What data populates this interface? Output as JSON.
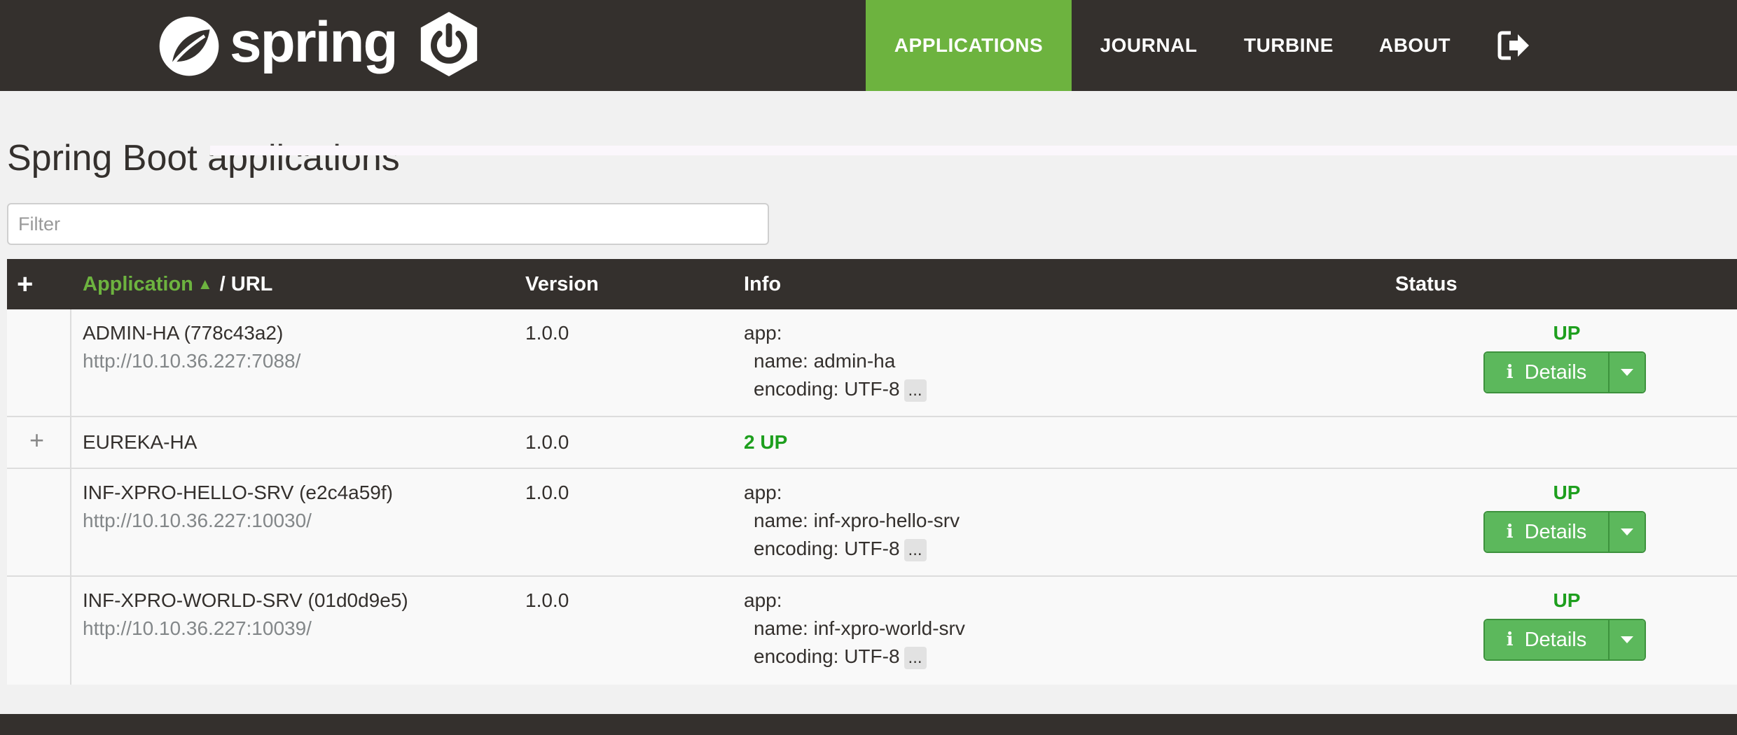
{
  "header": {
    "logo_text": "spring",
    "nav": [
      {
        "label": "APPLICATIONS",
        "active": true
      },
      {
        "label": "JOURNAL",
        "active": false
      },
      {
        "label": "TURBINE",
        "active": false
      },
      {
        "label": "ABOUT",
        "active": false
      }
    ],
    "logout_icon": "sign-out-icon",
    "accent_color": "#6db33f",
    "bar_color": "#34302d"
  },
  "page": {
    "title": "Spring Boot applications",
    "filter_placeholder": "Filter"
  },
  "table": {
    "headers": {
      "expand": "+",
      "application": "Application",
      "sort_indicator": "▲",
      "url_suffix": "/ URL",
      "version": "Version",
      "info": "Info",
      "status": "Status"
    },
    "rows": [
      {
        "name": "ADMIN-HA (778c43a2)",
        "url": "http://10.10.36.227:7088/",
        "version": "1.0.0",
        "info_app": "app:",
        "info_name": "name: admin-ha",
        "info_encoding": "encoding: UTF-8",
        "info_more": "...",
        "status": "UP",
        "details_label": "Details"
      },
      {
        "expand": "+",
        "name": "EUREKA-HA",
        "version": "1.0.0",
        "group_status": "2 UP"
      },
      {
        "name": "INF-XPRO-HELLO-SRV (e2c4a59f)",
        "url": "http://10.10.36.227:10030/",
        "version": "1.0.0",
        "info_app": "app:",
        "info_name": "name: inf-xpro-hello-srv",
        "info_encoding": "encoding: UTF-8",
        "info_more": "...",
        "status": "UP",
        "details_label": "Details"
      },
      {
        "name": "INF-XPRO-WORLD-SRV (01d0d9e5)",
        "url": "http://10.10.36.227:10039/",
        "version": "1.0.0",
        "info_app": "app:",
        "info_name": "name: inf-xpro-world-srv",
        "info_encoding": "encoding: UTF-8",
        "info_more": "...",
        "status": "UP",
        "details_label": "Details"
      }
    ]
  }
}
